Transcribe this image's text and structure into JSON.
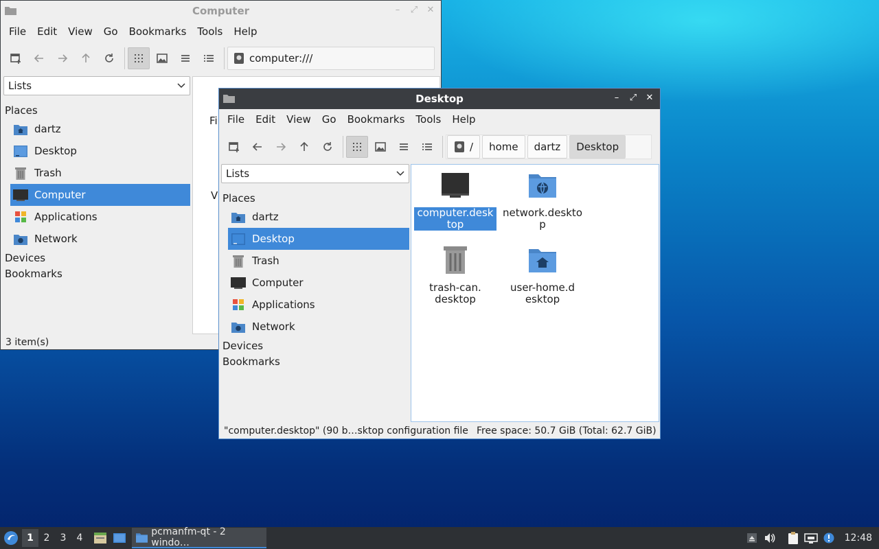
{
  "windows": {
    "back": {
      "title": "Computer",
      "address": "computer:///",
      "menu": [
        "File",
        "Edit",
        "View",
        "Go",
        "Bookmarks",
        "Tools",
        "Help"
      ],
      "side_combo": "Lists",
      "places_header": "Places",
      "places": [
        {
          "label": "dartz",
          "icon": "home-folder-icon"
        },
        {
          "label": "Desktop",
          "icon": "desktop-icon"
        },
        {
          "label": "Trash",
          "icon": "trash-icon"
        },
        {
          "label": "Computer",
          "icon": "computer-icon"
        },
        {
          "label": "Applications",
          "icon": "applications-icon"
        },
        {
          "label": "Network",
          "icon": "network-icon"
        }
      ],
      "devices_header": "Devices",
      "bookmarks_header": "Bookmarks",
      "peek_a": "Fi",
      "peek_b": "V",
      "status": "3 item(s)"
    },
    "front": {
      "title": "Desktop",
      "menu": [
        "File",
        "Edit",
        "View",
        "Go",
        "Bookmarks",
        "Tools",
        "Help"
      ],
      "breadcrumb": [
        "/",
        "home",
        "dartz",
        "Desktop"
      ],
      "side_combo": "Lists",
      "places_header": "Places",
      "places": [
        {
          "label": "dartz",
          "icon": "home-folder-icon"
        },
        {
          "label": "Desktop",
          "icon": "desktop-icon"
        },
        {
          "label": "Trash",
          "icon": "trash-icon"
        },
        {
          "label": "Computer",
          "icon": "computer-icon"
        },
        {
          "label": "Applications",
          "icon": "applications-icon"
        },
        {
          "label": "Network",
          "icon": "network-icon"
        }
      ],
      "devices_header": "Devices",
      "bookmarks_header": "Bookmarks",
      "files": [
        {
          "label": "computer.desktop",
          "icon": "monitor-icon",
          "selected": true
        },
        {
          "label": "network.desktop",
          "icon": "network-folder-icon",
          "selected": false
        },
        {
          "label": "trash-can.desktop",
          "icon": "trash-can-icon",
          "selected": false
        },
        {
          "label": "user-home.desktop",
          "icon": "home-folder-icon",
          "selected": false
        }
      ],
      "status_left": "\"computer.desktop\" (90 b…sktop configuration file",
      "status_right": "Free space: 50.7 GiB (Total: 62.7 GiB)"
    }
  },
  "taskbar": {
    "workspaces": [
      "1",
      "2",
      "3",
      "4"
    ],
    "current_workspace": "1",
    "task_label": "pcmanfm-qt - 2 windo…",
    "clock": "12:48"
  },
  "colors": {
    "accent": "#3f89d9",
    "titlebar": "#3a3d41",
    "taskbar": "#2d3034"
  }
}
